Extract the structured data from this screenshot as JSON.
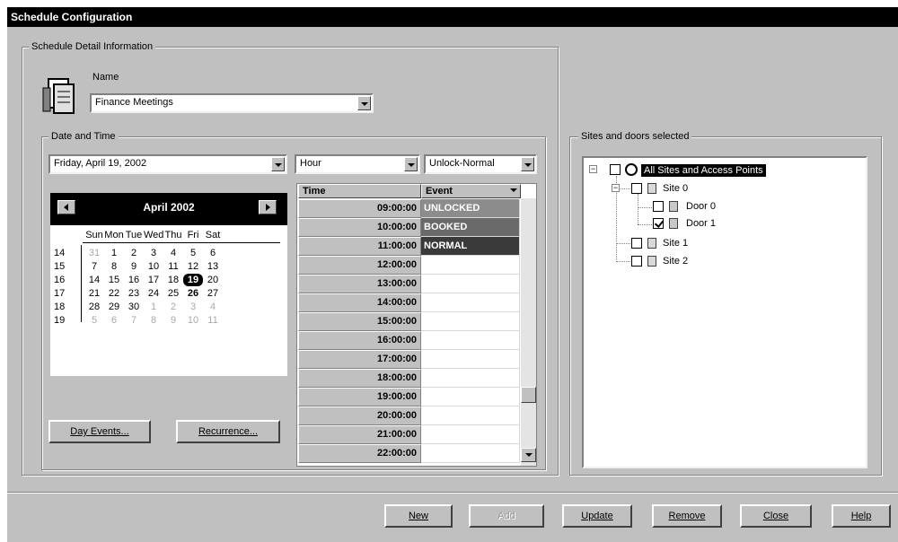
{
  "window": {
    "title": "Schedule Configuration"
  },
  "schedule_detail": {
    "group_label": "Schedule Detail Information",
    "name_label": "Name",
    "name_value": "Finance Meetings"
  },
  "date_time": {
    "group_label": "Date and Time",
    "date_value": "Friday, April 19, 2002",
    "interval_value": "Hour",
    "mode_value": "Unlock-Normal"
  },
  "calendar": {
    "month_title": "April 2002",
    "weekdays": [
      "Sun",
      "Mon",
      "Tue",
      "Wed",
      "Thu",
      "Fri",
      "Sat"
    ],
    "weeks": [
      {
        "num": "14",
        "days": [
          "31",
          "1",
          "2",
          "3",
          "4",
          "5",
          "6"
        ]
      },
      {
        "num": "15",
        "days": [
          "7",
          "8",
          "9",
          "10",
          "11",
          "12",
          "13"
        ]
      },
      {
        "num": "16",
        "days": [
          "14",
          "15",
          "16",
          "17",
          "18",
          "19",
          "20"
        ]
      },
      {
        "num": "17",
        "days": [
          "21",
          "22",
          "23",
          "24",
          "25",
          "26",
          "27"
        ]
      },
      {
        "num": "18",
        "days": [
          "28",
          "29",
          "30",
          "1",
          "2",
          "3",
          "4"
        ]
      },
      {
        "num": "19",
        "days": [
          "5",
          "6",
          "7",
          "8",
          "9",
          "10",
          "11"
        ]
      }
    ],
    "selected_day": "19",
    "today_day": "26"
  },
  "buttons": {
    "day_events": "Day Events...",
    "recurrence": "Recurrence...",
    "new": "New",
    "add": "Add",
    "update": "Update",
    "remove": "Remove",
    "close": "Close",
    "help": "Help"
  },
  "grid": {
    "time_header": "Time",
    "event_header": "Event",
    "rows": [
      {
        "time": "09:00:00",
        "event": "UNLOCKED"
      },
      {
        "time": "10:00:00",
        "event": "BOOKED"
      },
      {
        "time": "11:00:00",
        "event": "NORMAL"
      },
      {
        "time": "12:00:00",
        "event": ""
      },
      {
        "time": "13:00:00",
        "event": ""
      },
      {
        "time": "14:00:00",
        "event": ""
      },
      {
        "time": "15:00:00",
        "event": ""
      },
      {
        "time": "16:00:00",
        "event": ""
      },
      {
        "time": "17:00:00",
        "event": ""
      },
      {
        "time": "18:00:00",
        "event": ""
      },
      {
        "time": "19:00:00",
        "event": ""
      },
      {
        "time": "20:00:00",
        "event": ""
      },
      {
        "time": "21:00:00",
        "event": ""
      },
      {
        "time": "22:00:00",
        "event": ""
      }
    ],
    "event_colors": {
      "UNLOCKED": "#8c8c8c",
      "BOOKED": "#6a6a6a",
      "NORMAL": "#3a3a3a"
    }
  },
  "sites": {
    "group_label": "Sites and doors selected",
    "root": "All Sites and Access Points",
    "site0": "Site 0",
    "door0": "Door 0",
    "door1": "Door 1",
    "site1": "Site 1",
    "site2": "Site 2",
    "door1_checked": true
  }
}
